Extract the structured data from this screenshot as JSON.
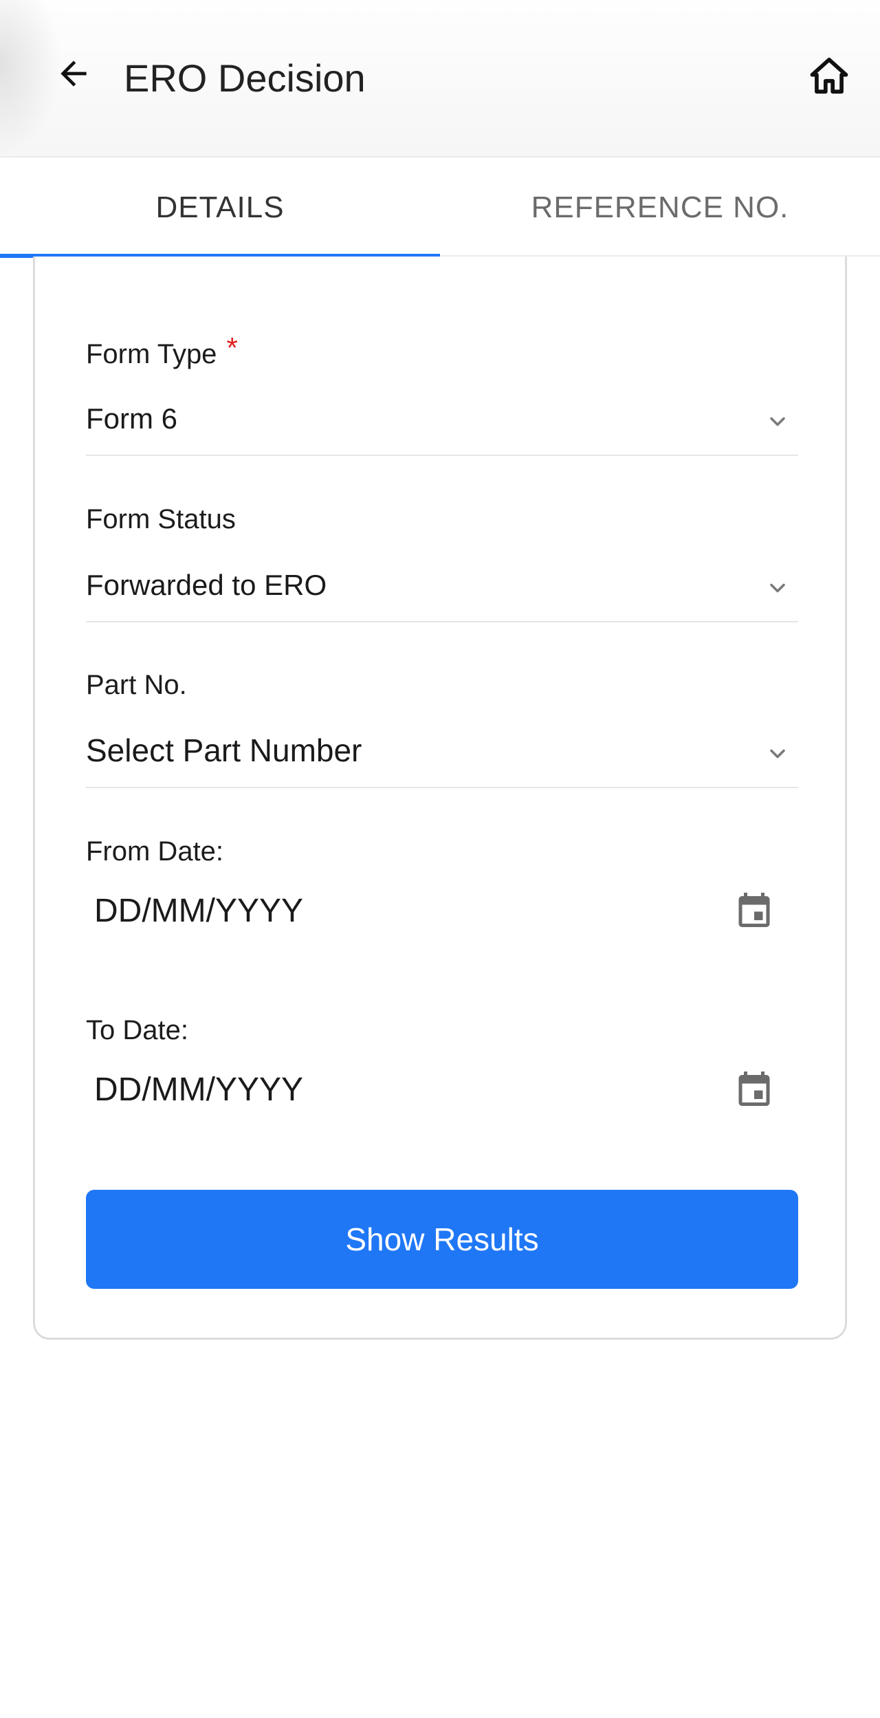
{
  "header": {
    "title": "ERO Decision",
    "back_icon": "arrow-left-icon",
    "home_icon": "home-icon"
  },
  "tabs": [
    {
      "label": "DETAILS",
      "active": true
    },
    {
      "label": "REFERENCE NO.",
      "active": false
    }
  ],
  "form": {
    "form_type": {
      "label": "Form Type",
      "required_mark": "*",
      "value": "Form 6"
    },
    "form_status": {
      "label": "Form Status",
      "value": "Forwarded to ERO"
    },
    "part_no": {
      "label": "Part No.",
      "value": "Select Part Number"
    },
    "from_date": {
      "label": "From Date:",
      "placeholder": "DD/MM/YYYY"
    },
    "to_date": {
      "label": "To Date:",
      "placeholder": "DD/MM/YYYY"
    },
    "submit_label": "Show Results"
  },
  "colors": {
    "accent": "#1f77f6",
    "required": "#e02020"
  }
}
